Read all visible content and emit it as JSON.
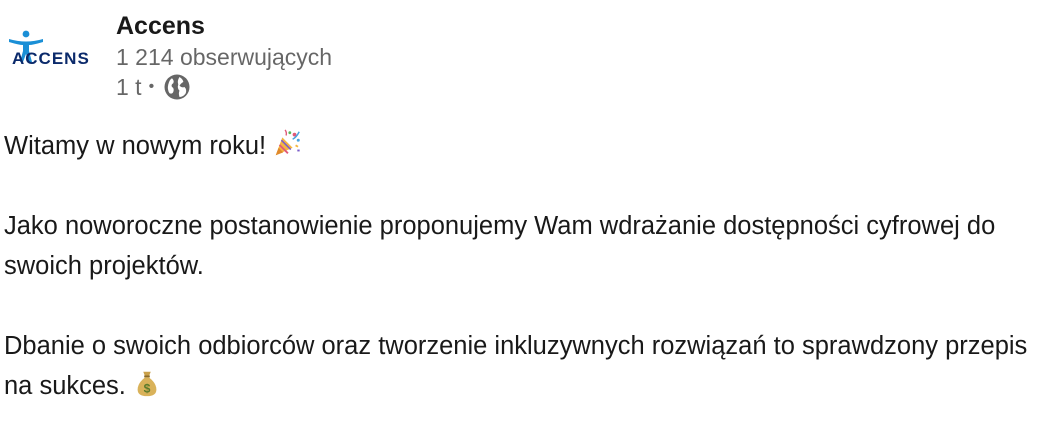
{
  "post": {
    "company_name": "Accens",
    "logo_text": "ACCENS",
    "followers": "1 214 obserwujących",
    "time": "1 t",
    "separator": "•",
    "visibility_icon": "globe-icon",
    "paragraphs": [
      "Witamy w nowym roku!",
      "Jako noworoczne postanowienie proponujemy Wam wdrażanie dostępności cyfrowej do swoich projektów.",
      "Dbanie o swoich odbiorców oraz tworzenie inkluzywnych rozwiązań to sprawdzony przepis na sukces."
    ],
    "emojis": [
      "party-popper-icon",
      "money-bag-icon"
    ]
  },
  "colors": {
    "logo_blue": "#1a8fd6",
    "logo_navy": "#0b2a6b",
    "text_primary": "#191919",
    "text_secondary": "#666666"
  }
}
